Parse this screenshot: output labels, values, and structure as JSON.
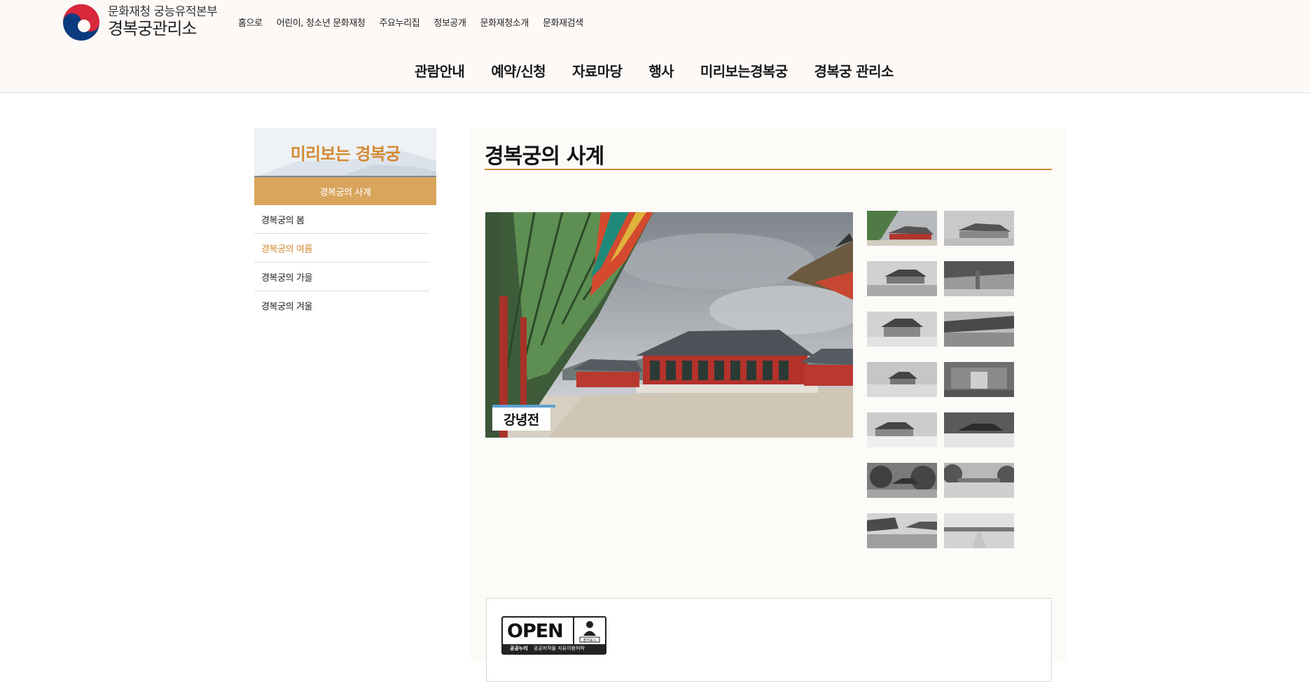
{
  "header": {
    "logo_line1": "문화재청 궁능유적본부",
    "logo_line2": "경복궁관리소",
    "util_nav": [
      "홈으로",
      "어린이, 청소년 문화재청",
      "주요누리집",
      "정보공개",
      "문화재청소개",
      "문화재검색"
    ],
    "gnb": [
      "관람안내",
      "예약/신청",
      "자료마당",
      "행사",
      "미리보는경복궁",
      "경복궁 관리소"
    ]
  },
  "sidebar": {
    "title": "미리보는 경복궁",
    "active": "경복궁의 사계",
    "items": [
      {
        "label": "경복궁의 봄",
        "selected": false
      },
      {
        "label": "경복궁의 여름",
        "selected": true
      },
      {
        "label": "경복궁의 가을",
        "selected": false
      },
      {
        "label": "경복궁의 겨울",
        "selected": false
      }
    ]
  },
  "content": {
    "title": "경복궁의 사계",
    "main_caption": "강녕전",
    "thumbnail_count": 14
  },
  "license": {
    "word": "OPEN",
    "badge_small": "출처표시",
    "bottom_label": "공공누리",
    "bottom_text": "공공저작물 자유이용허락"
  },
  "colors": {
    "accent": "#d48a32",
    "sidebar_active_bg": "#d9a55d",
    "header_bg": "#fdf9f7",
    "content_bg": "#fcfbf8"
  }
}
